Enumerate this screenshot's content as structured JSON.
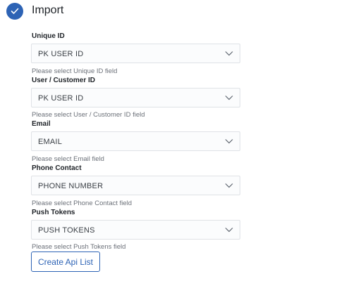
{
  "header": {
    "title": "Import",
    "icon": "checkmark-icon",
    "accent_color": "#2d63b5"
  },
  "fields": [
    {
      "label": "Unique ID",
      "value": "PK USER ID",
      "help": "Please select Unique ID field"
    },
    {
      "label": "User / Customer ID",
      "value": "PK USER ID",
      "help": "Please select User / Customer ID field"
    },
    {
      "label": "Email",
      "value": "EMAIL",
      "help": "Please select Email field"
    },
    {
      "label": "Phone Contact",
      "value": "PHONE NUMBER",
      "help": "Please select Phone Contact field"
    },
    {
      "label": "Push Tokens",
      "value": "PUSH TOKENS",
      "help": "Please select Push Tokens field"
    }
  ],
  "actions": {
    "create_label": "Create Api List"
  }
}
